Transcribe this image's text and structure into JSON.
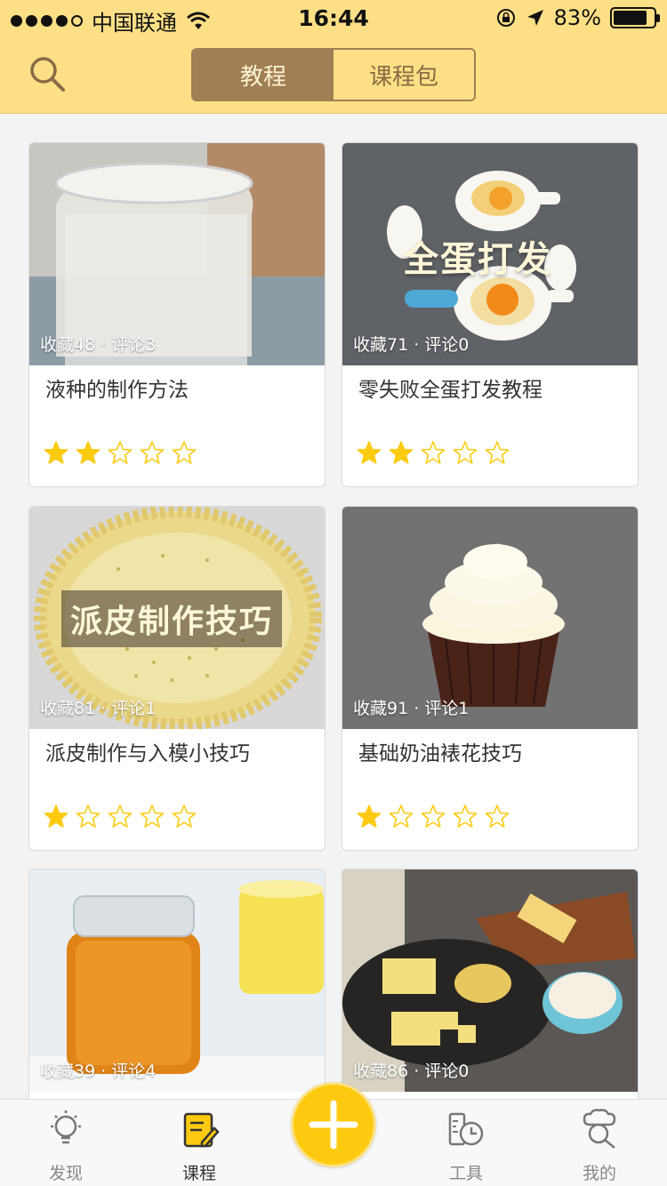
{
  "status_bar": {
    "carrier": "中国联通",
    "time": "16:44",
    "battery_percent": "83%",
    "battery_level": 0.83
  },
  "header": {
    "tabs": [
      {
        "label": "教程",
        "active": true
      },
      {
        "label": "课程包",
        "active": false
      }
    ]
  },
  "cards": [
    {
      "stats": "收藏48 · 评论3",
      "title": "液种的制作方法",
      "rating": 2,
      "image_overlay": ""
    },
    {
      "stats": "收藏71 · 评论0",
      "title": "零失败全蛋打发教程",
      "rating": 2,
      "image_overlay": "全蛋打发"
    },
    {
      "stats": "收藏81 · 评论1",
      "title": "派皮制作与入模小技巧",
      "rating": 1,
      "image_overlay": "派皮制作技巧"
    },
    {
      "stats": "收藏91 · 评论1",
      "title": "基础奶油裱花技巧",
      "rating": 1,
      "image_overlay": ""
    },
    {
      "stats": "收藏39 · 评论4",
      "title": "",
      "rating": 0,
      "image_overlay": ""
    },
    {
      "stats": "收藏86 · 评论0",
      "title": "",
      "rating": 0,
      "image_overlay": ""
    }
  ],
  "tabbar": {
    "items": [
      {
        "label": "发现",
        "icon": "lightbulb-icon",
        "active": false
      },
      {
        "label": "课程",
        "icon": "notebook-icon",
        "active": true
      },
      {
        "label": "工具",
        "icon": "timer-icon",
        "active": false
      },
      {
        "label": "我的",
        "icon": "chef-icon",
        "active": false
      }
    ],
    "fab_icon": "plus-icon"
  },
  "colors": {
    "header_bg": "#fddf85",
    "segment_active": "#a07f55",
    "star": "#fdca10",
    "fab": "#fdca10"
  }
}
